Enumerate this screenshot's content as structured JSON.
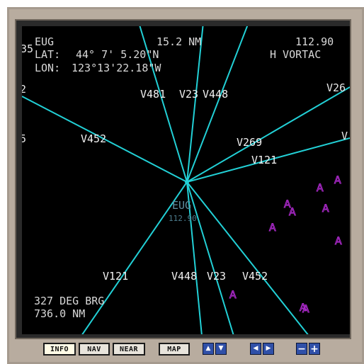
{
  "colors": {
    "airway": "#22d0d6",
    "terrain_marker": "#b02ad0",
    "text": "#d8d8d8",
    "airway_label": "#f2f2f2",
    "station_label": "#5f8fa0",
    "screen_bg": "#000000",
    "frame": "#b8ac9f"
  },
  "header": {
    "station_id": "EUG",
    "distance": "15.2 NM",
    "frequency": "112.90",
    "lat_label": "LAT:",
    "lat_value": "44° 7' 5.20\"N",
    "lon_label": "LON:",
    "lon_value": "123°13'22.18\"W",
    "station_type": "H VORTAC"
  },
  "edge_labels": {
    "left_top": "35",
    "left_mid": "2",
    "left_low": "5",
    "right_top": "V26",
    "right_mid": "V"
  },
  "airway_labels": {
    "v481": "V481",
    "v23_top": "V23",
    "v448_top": "V448",
    "v452_left": "V452",
    "v269": "V269",
    "v121_right": "V121",
    "v121_bottom": "V121",
    "v448_bottom": "V448",
    "v23_bottom": "V23",
    "v452_bottom": "V452"
  },
  "station": {
    "name": "EUG",
    "freq": "112.90"
  },
  "bearing": {
    "bearing_text": "327 DEG BRG",
    "distance_text": "736.0 NM"
  },
  "terrain": {
    "marker_glyph": "A"
  },
  "toolbar": {
    "info_label": "INFO",
    "nav_label": "NAV",
    "near_label": "NEAR",
    "map_label": "MAP",
    "up_arrow": "▲",
    "down_arrow": "▼",
    "left_arrow": "◀",
    "right_arrow": "▶",
    "minus_label": "−",
    "plus_label": "+"
  }
}
